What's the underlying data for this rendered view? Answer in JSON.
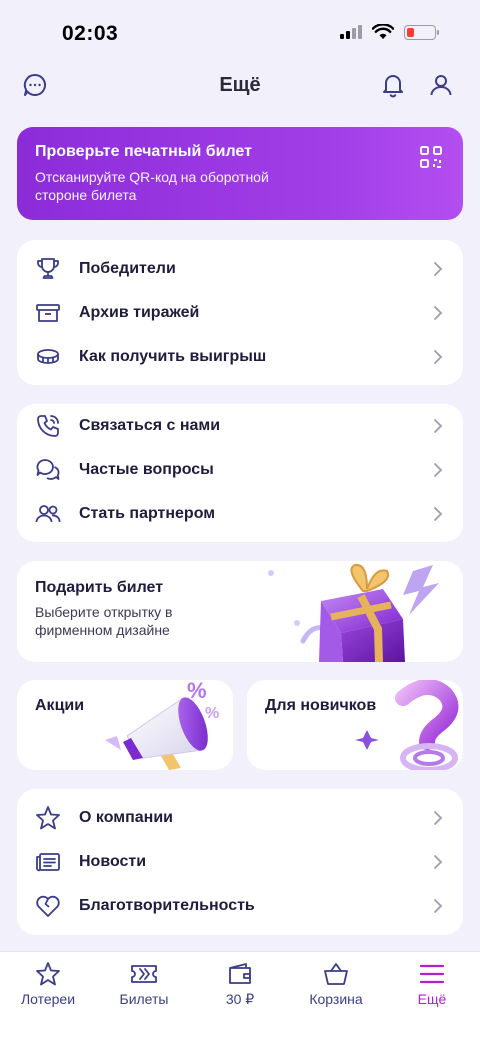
{
  "status_bar": {
    "time": "02:03"
  },
  "header": {
    "title": "Ещё"
  },
  "banner": {
    "title": "Проверьте печатный билет",
    "subtitle": "Отсканируйте QR-код на оборотной стороне билета"
  },
  "group1": [
    {
      "label": "Победители",
      "icon": "trophy-icon"
    },
    {
      "label": "Архив тиражей",
      "icon": "archive-box-icon"
    },
    {
      "label": "Как получить выигрыш",
      "icon": "coins-icon"
    }
  ],
  "group2": [
    {
      "label": "Связаться с нами",
      "icon": "phone-icon"
    },
    {
      "label": "Частые вопросы",
      "icon": "chat-bubbles-icon"
    },
    {
      "label": "Стать партнером",
      "icon": "users-icon"
    }
  ],
  "gift": {
    "title": "Подарить билет",
    "subtitle": "Выберите открытку в фирменном дизайне"
  },
  "tiles": {
    "promotions": "Акции",
    "newcomers": "Для новичков"
  },
  "group3": [
    {
      "label": "О компании",
      "icon": "star-icon"
    },
    {
      "label": "Новости",
      "icon": "news-icon"
    },
    {
      "label": "Благотворительность",
      "icon": "heart-icon"
    }
  ],
  "tabbar": [
    {
      "label": "Лотереи",
      "icon": "star-icon"
    },
    {
      "label": "Билеты",
      "icon": "ticket-icon"
    },
    {
      "label": "30 ₽",
      "icon": "wallet-icon"
    },
    {
      "label": "Корзина",
      "icon": "shopping-bag-icon"
    },
    {
      "label": "Ещё",
      "icon": "menu-icon",
      "active": true
    }
  ],
  "colors": {
    "accent": "#b21fd1",
    "navy": "#3b3d8a",
    "banner_start": "#8c2cd9",
    "banner_end": "#b34ff0"
  }
}
